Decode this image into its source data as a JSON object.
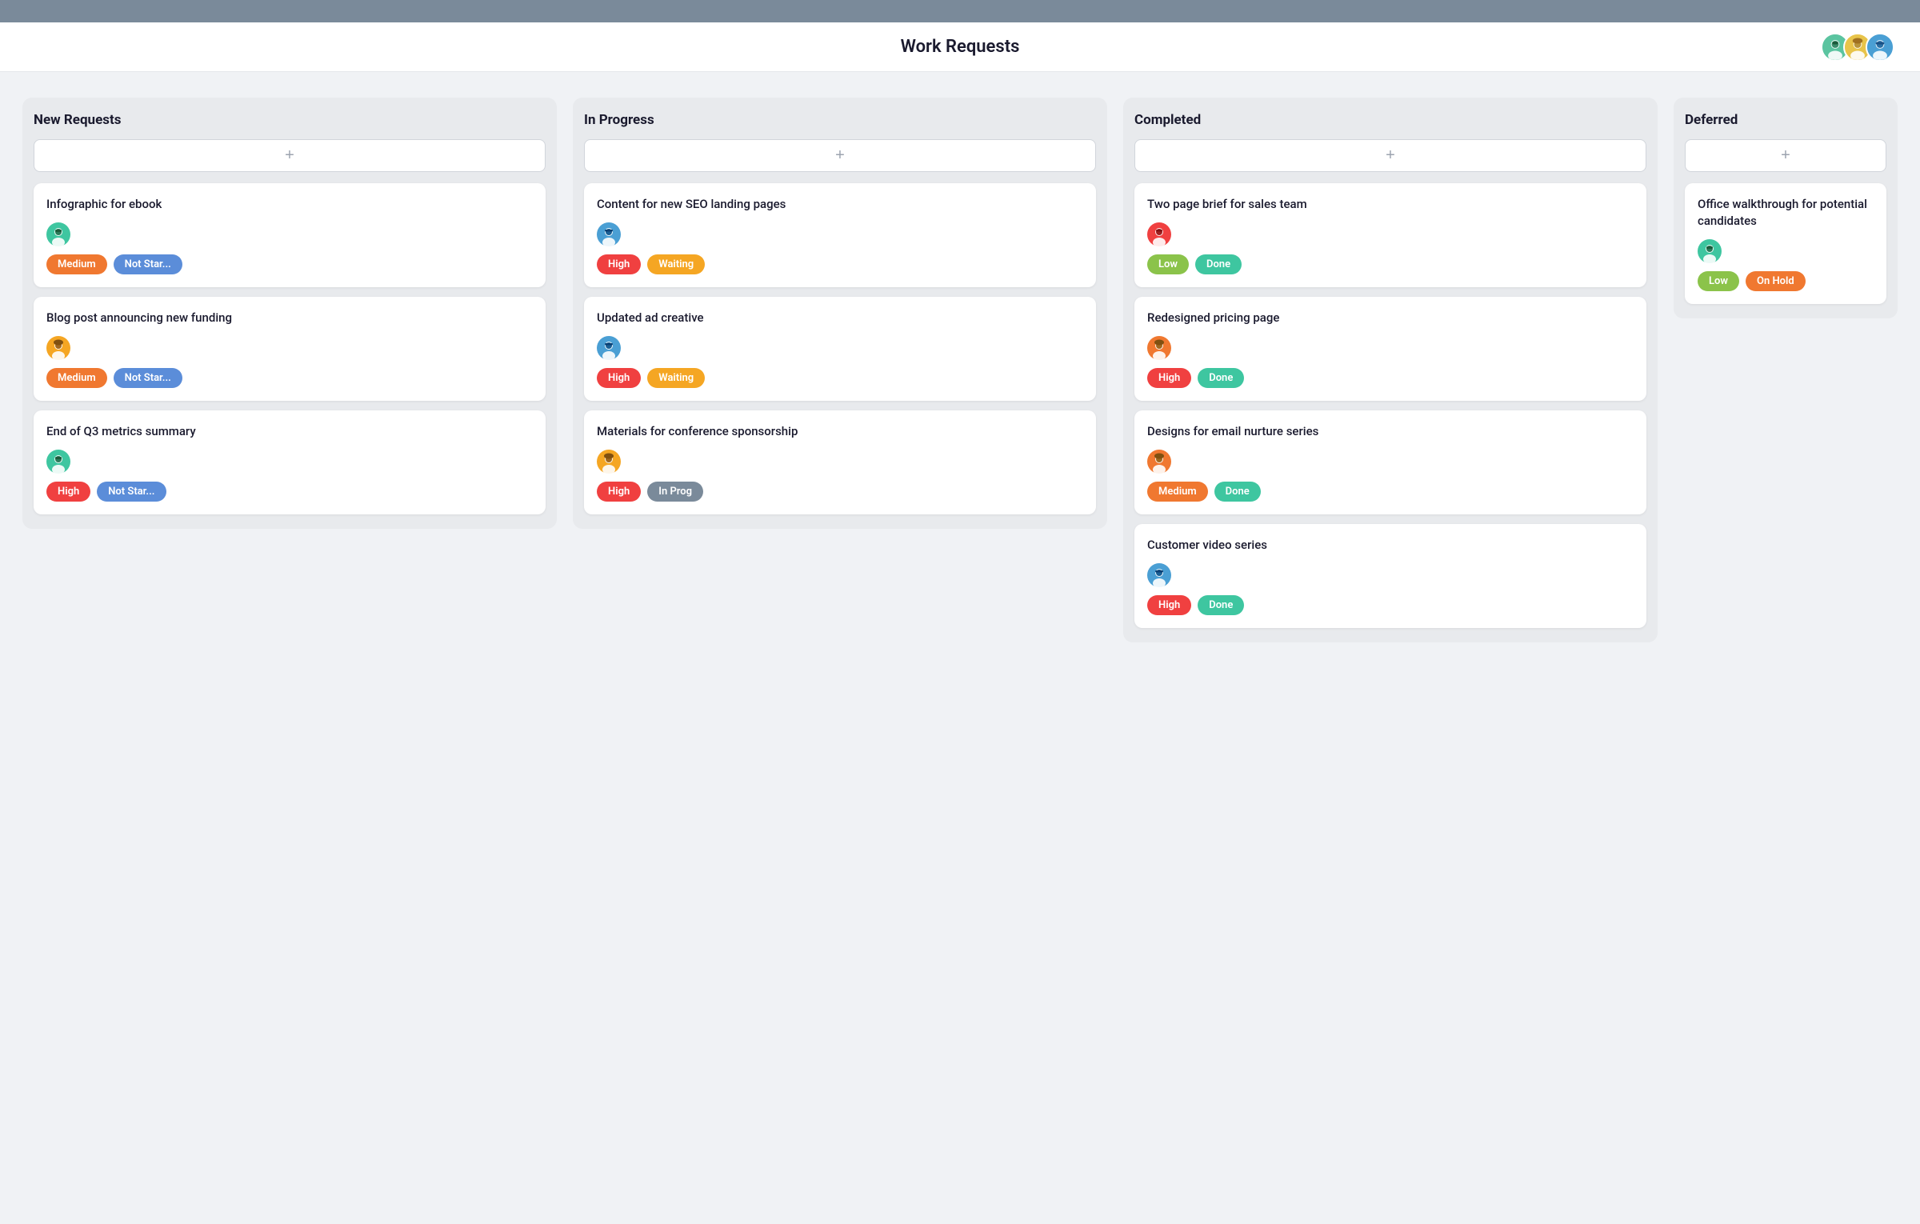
{
  "header": {
    "title": "Work Requests",
    "avatars": [
      {
        "id": "avatar-1",
        "color": "#5bc4a0",
        "emoji": "🧑"
      },
      {
        "id": "avatar-2",
        "color": "#e8c44a",
        "emoji": "👩"
      },
      {
        "id": "avatar-3",
        "color": "#4a9fd4",
        "emoji": "🧔"
      }
    ]
  },
  "columns": [
    {
      "id": "new-requests",
      "title": "New Requests",
      "add_label": "+",
      "cards": [
        {
          "id": "card-1",
          "title": "Infographic for ebook",
          "avatar_color": "#3ec6a0",
          "avatar_emoji": "🧑",
          "badges": [
            {
              "label": "Medium",
              "type": "medium"
            },
            {
              "label": "Not Star...",
              "type": "not-started"
            }
          ]
        },
        {
          "id": "card-2",
          "title": "Blog post announcing new funding",
          "avatar_color": "#f5a623",
          "avatar_emoji": "👩",
          "badges": [
            {
              "label": "Medium",
              "type": "medium"
            },
            {
              "label": "Not Star...",
              "type": "not-started"
            }
          ]
        },
        {
          "id": "card-3",
          "title": "End of Q3 metrics summary",
          "avatar_color": "#3ec6a0",
          "avatar_emoji": "🧑",
          "badges": [
            {
              "label": "High",
              "type": "high"
            },
            {
              "label": "Not Star...",
              "type": "not-started"
            }
          ]
        }
      ]
    },
    {
      "id": "in-progress",
      "title": "In Progress",
      "add_label": "+",
      "cards": [
        {
          "id": "card-4",
          "title": "Content for new SEO landing pages",
          "avatar_color": "#4a9fd4",
          "avatar_emoji": "🧔",
          "badges": [
            {
              "label": "High",
              "type": "high"
            },
            {
              "label": "Waiting",
              "type": "waiting"
            }
          ]
        },
        {
          "id": "card-5",
          "title": "Updated ad creative",
          "avatar_color": "#4a9fd4",
          "avatar_emoji": "🧔",
          "badges": [
            {
              "label": "High",
              "type": "high"
            },
            {
              "label": "Waiting",
              "type": "waiting"
            }
          ]
        },
        {
          "id": "card-6",
          "title": "Materials for conference sponsorship",
          "avatar_color": "#f5a623",
          "avatar_emoji": "👩",
          "badges": [
            {
              "label": "High",
              "type": "high"
            },
            {
              "label": "In Prog",
              "type": "in-progress"
            }
          ]
        }
      ]
    },
    {
      "id": "completed",
      "title": "Completed",
      "add_label": "+",
      "cards": [
        {
          "id": "card-7",
          "title": "Two page brief for sales team",
          "avatar_color": "#f04040",
          "avatar_emoji": "🧑",
          "badges": [
            {
              "label": "Low",
              "type": "low"
            },
            {
              "label": "Done",
              "type": "done"
            }
          ]
        },
        {
          "id": "card-8",
          "title": "Redesigned pricing page",
          "avatar_color": "#f07830",
          "avatar_emoji": "👩",
          "badges": [
            {
              "label": "High",
              "type": "high"
            },
            {
              "label": "Done",
              "type": "done"
            }
          ]
        },
        {
          "id": "card-9",
          "title": "Designs for email nurture series",
          "avatar_color": "#f07830",
          "avatar_emoji": "👩",
          "badges": [
            {
              "label": "Medium",
              "type": "medium"
            },
            {
              "label": "Done",
              "type": "done"
            }
          ]
        },
        {
          "id": "card-10",
          "title": "Customer video series",
          "avatar_color": "#4a9fd4",
          "avatar_emoji": "🧔",
          "badges": [
            {
              "label": "High",
              "type": "high"
            },
            {
              "label": "Done",
              "type": "done"
            }
          ]
        }
      ]
    },
    {
      "id": "deferred",
      "title": "Deferred",
      "add_label": "+",
      "cards": [
        {
          "id": "card-11",
          "title": "Office walkthrough for potential candidates",
          "avatar_color": "#3ec6a0",
          "avatar_emoji": "🧑",
          "badges": [
            {
              "label": "Low",
              "type": "low"
            },
            {
              "label": "On Hold",
              "type": "on-hold"
            }
          ]
        }
      ]
    }
  ],
  "badge_types": {
    "high": "badge-high",
    "medium": "badge-medium",
    "low": "badge-low",
    "not-started": "badge-not-started",
    "waiting": "badge-waiting",
    "done": "badge-done",
    "in-progress": "badge-in-progress",
    "on-hold": "badge-on-hold"
  }
}
